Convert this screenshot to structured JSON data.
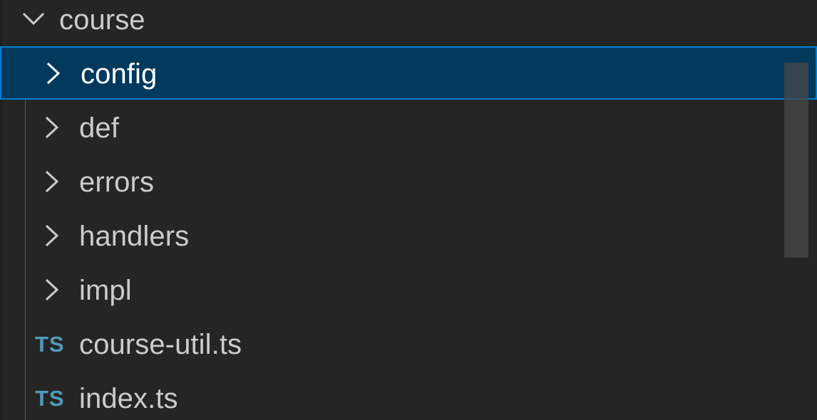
{
  "explorer": {
    "root": {
      "label": "course",
      "icon": "chevron-down-icon"
    },
    "items": [
      {
        "label": "config",
        "icon": "chevron-right-icon",
        "selected": true,
        "type": "folder"
      },
      {
        "label": "def",
        "icon": "chevron-right-icon",
        "type": "folder"
      },
      {
        "label": "errors",
        "icon": "chevron-right-icon",
        "type": "folder"
      },
      {
        "label": "handlers",
        "icon": "chevron-right-icon",
        "type": "folder"
      },
      {
        "label": "impl",
        "icon": "chevron-right-icon",
        "type": "folder"
      },
      {
        "label": "course-util.ts",
        "icon": "typescript-file-icon",
        "file_icon_text": "TS",
        "type": "file"
      },
      {
        "label": "index.ts",
        "icon": "typescript-file-icon",
        "file_icon_text": "TS",
        "type": "file"
      }
    ]
  },
  "colors": {
    "background": "#252526",
    "selected_background": "#04395e",
    "selected_border": "#007fd4",
    "text": "#cccccc",
    "selected_text": "#ffffff",
    "typescript_icon": "#519aba"
  }
}
